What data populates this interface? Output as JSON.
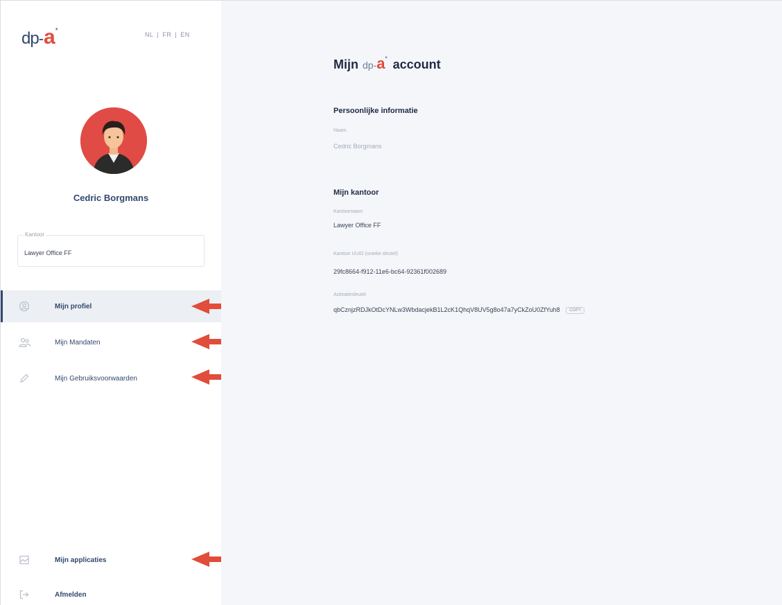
{
  "logo": {
    "dp": "dp",
    "dash": "-",
    "a": "a",
    "star": "*"
  },
  "languages": [
    "NL",
    "|",
    "FR",
    "|",
    "EN"
  ],
  "user": {
    "name": "Cedric Borgmans"
  },
  "office_select": {
    "legend": "Kantoor",
    "value": "Lawyer Office FF"
  },
  "nav": {
    "profile": "Mijn profiel",
    "mandates": "Mijn Mandaten",
    "terms": "Mijn Gebruiksvoorwaarden",
    "applications": "Mijn applicaties",
    "logout": "Afmelden"
  },
  "icons": {
    "profile": "user-circle-icon",
    "mandates": "users-icon",
    "terms": "pen-icon",
    "applications": "image-icon",
    "logout": "logout-icon"
  },
  "colors": {
    "accent": "#e24c3a",
    "brand": "#33486e",
    "arrow": "#e24c3a",
    "main_bg": "#f4f6f9",
    "active_bg": "#eceff3"
  },
  "main": {
    "title_before": "Mijn",
    "title_after": "account",
    "personal": {
      "title": "Persoonlijke informatie",
      "name_label": "Naam",
      "name_value": "Cedric Borgmans"
    },
    "office": {
      "title": "Mijn kantoor",
      "office_name_label": "Kantoornaam",
      "office_name_value": "Lawyer Office FF",
      "uuid_label": "Kantoor UUID (unieke sleutel)",
      "uuid_value": "29fc8664-f912-11e6-bc64-92361f002689",
      "activation_label": "Activatiesleutel",
      "activation_value": "qbCznjzRDJkOtDcYNLw3WbdacjekB1L2cK1QhqV8UV5g8o47a7yCkZoU0ZfYuh8",
      "copy_label": "COPY"
    }
  }
}
